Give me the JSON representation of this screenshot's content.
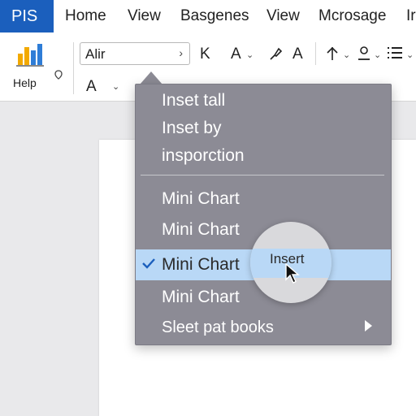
{
  "menubar": {
    "app_badge": "PIS",
    "items": [
      "Home",
      "View",
      "Basgenes",
      "View",
      "Mcrosage",
      "Ir"
    ]
  },
  "ribbon": {
    "help_label": "Help",
    "font_name": "Alir",
    "tool_k": "K",
    "tool_a": "A",
    "tool_a2": "A",
    "tool_a3": "A"
  },
  "context_menu": {
    "items": [
      "Inset tall",
      "Inset by",
      "insporction",
      "Mini Chart",
      "Mini Chart",
      "Mini Chart",
      "Mini Chart",
      "Sleet pat books"
    ],
    "selected_index": 5
  },
  "magnifier": {
    "label": "Insert"
  },
  "colors": {
    "accent": "#1b5fbd",
    "menu_bg": "#8c8b95",
    "highlight": "#b9d8f6"
  }
}
